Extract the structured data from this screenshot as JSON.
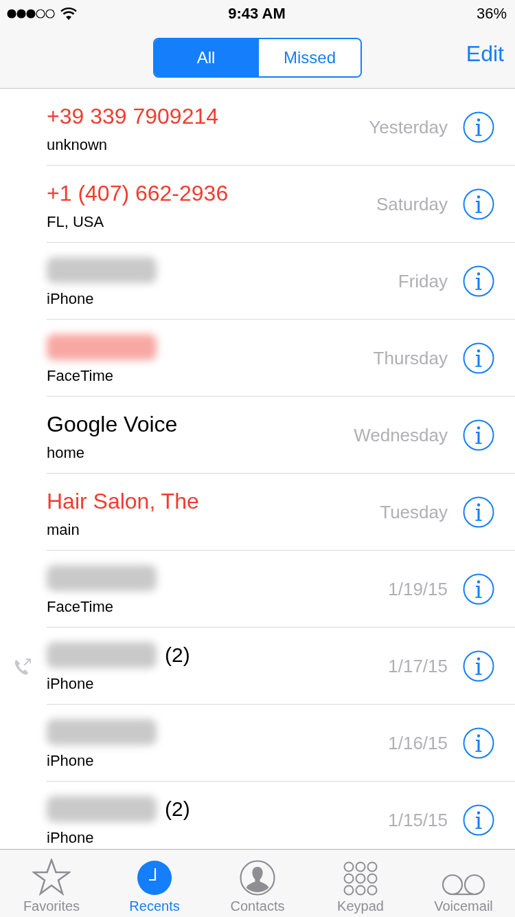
{
  "status_bar": {
    "time": "9:43 AM",
    "battery": "36%"
  },
  "segments": [
    {
      "label": "All",
      "selected": true
    },
    {
      "label": "Missed",
      "selected": false
    }
  ],
  "edit_button": "Edit",
  "calls": [
    {
      "kind": "text",
      "name": "+39 339 7909214",
      "missed": true,
      "outgoing": false,
      "subtitle": "unknown",
      "date": "Yesterday"
    },
    {
      "kind": "text",
      "name": "+1 (407) 662-2936",
      "missed": true,
      "outgoing": false,
      "subtitle": "FL, USA",
      "date": "Saturday"
    },
    {
      "kind": "blurred",
      "missed": false,
      "outgoing": false,
      "subtitle": "iPhone",
      "date": "Friday"
    },
    {
      "kind": "blurred",
      "missed": true,
      "outgoing": false,
      "subtitle": "FaceTime",
      "date": "Thursday"
    },
    {
      "kind": "text",
      "name": "Google Voice",
      "missed": false,
      "outgoing": false,
      "subtitle": "home",
      "date": "Wednesday"
    },
    {
      "kind": "text",
      "name": "Hair Salon, The",
      "missed": true,
      "outgoing": false,
      "subtitle": "main",
      "date": "Tuesday"
    },
    {
      "kind": "blurred",
      "missed": false,
      "outgoing": false,
      "subtitle": "FaceTime",
      "date": "1/19/15"
    },
    {
      "kind": "blurred",
      "missed": false,
      "outgoing": true,
      "count": "(2)",
      "subtitle": "iPhone",
      "date": "1/17/15"
    },
    {
      "kind": "blurred",
      "missed": false,
      "outgoing": false,
      "subtitle": "iPhone",
      "date": "1/16/15"
    },
    {
      "kind": "blurred",
      "missed": false,
      "outgoing": false,
      "count": "(2)",
      "subtitle": "iPhone",
      "date": "1/15/15"
    }
  ],
  "tab_bar": [
    {
      "label": "Favorites",
      "kind": "star",
      "selected": false
    },
    {
      "label": "Recents",
      "kind": "clock",
      "selected": true
    },
    {
      "label": "Contacts",
      "kind": "person",
      "selected": false
    },
    {
      "label": "Keypad",
      "kind": "keypad",
      "selected": false
    },
    {
      "label": "Voicemail",
      "kind": "voicemail",
      "selected": false
    }
  ]
}
